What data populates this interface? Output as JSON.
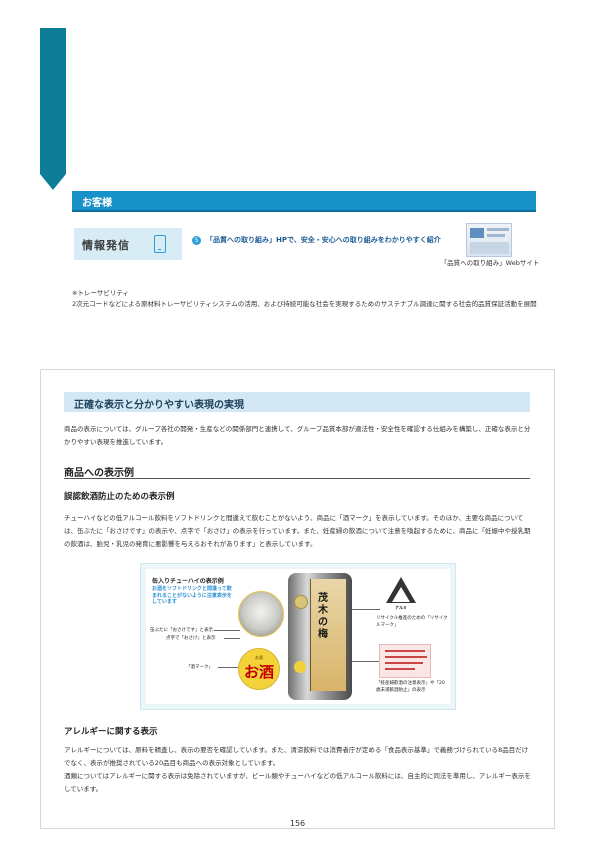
{
  "customer": {
    "header": "お客様"
  },
  "info": {
    "label": "情報発信",
    "bullet": "5",
    "text": "「品質への取り組み」HPで、安全・安心への取り組みをわかりやすく紹介",
    "thumbnail_caption": "「品質への取り組み」Webサイト"
  },
  "note": {
    "title": "※トレーサビリティ",
    "body": "2次元コードなどによる原材料トレーサビリティシステムの活用、および持続可能な社会を実現するためのサステナブル調達に関する社会的品質保証活動を展開"
  },
  "section": {
    "title": "正確な表示と分かりやすい表現の実現",
    "intro": "商品の表示については、グループ各社の開発・生産などの関係部門と連携して、グループ品質本部が適法性・安全性を確認する仕組みを構築し、正確な表示と分かりやすい表現を推進しています。",
    "subtitle": "商品への表示例",
    "misdrink": {
      "title": "誤認飲酒防止のための表示例",
      "body": "チューハイなどの低アルコール飲料をソフトドリンクと間違えて飲むことがないよう、商品に「酒マーク」を表示しています。そのほか、主要な商品については、缶ぶたに「おさけです」の表示や、点字で「おさけ」の表示を行っています。また、妊産婦の飲酒について注意を喚起するために、商品に「妊娠中や授乳期の飲酒は、胎児・乳児の発育に悪影響を与えるおそれがあります」と表示しています。"
    },
    "figure": {
      "title": "缶入りチューハイの表示例",
      "blue_text": "お酒をソフトドリンクと間違って飲まれることがないように注意表示をしています",
      "label_lid": "缶ぶたに「おさけです」と表示",
      "label_braille": "点字で「おさけ」と表示",
      "label_mark": "「酒マーク」",
      "mark_small": "お酒",
      "mark_big": "お酒",
      "can_text": "茂木の梅",
      "recycle_text": "アルミ",
      "label_recycle": "リサイクル推進のための「リサイクルマーク」",
      "label_warning": "「妊産婦飲酒の注意表示」や「20歳未満飲酒防止」の表示"
    },
    "allergy": {
      "title": "アレルギーに関する表示",
      "body1": "アレルギーについては、原料を精査し、表示の要否を確認しています。また、清涼飲料では消費者庁が定める「食品表示基準」で義務づけられている8品目だけでなく、表示が推奨されている20品目も商品への表示対象としています。",
      "body2": "酒類についてはアレルギーに関する表示は免除されていますが、ビール類やチューハイなどの低アルコール飲料には、自主的に同法を準用し、アレルギー表示をしています。"
    }
  },
  "page_number": "156",
  "colors": {
    "accent": "#0e7d98",
    "header_blue": "#1890c8",
    "light_blue": "#d3e8f4"
  }
}
